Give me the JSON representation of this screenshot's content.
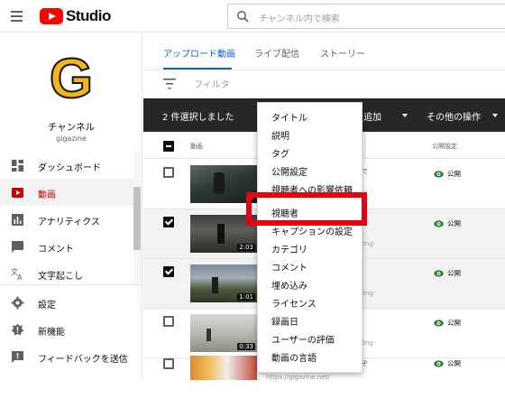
{
  "header": {
    "logo_text": "Studio",
    "search_placeholder": "チャンネル内で検索",
    "colors": {
      "brand": "#ff0000",
      "accent": "#065fd4",
      "active_nav": "#cc0000",
      "highlight": "#e60012"
    }
  },
  "sidebar": {
    "avatar_letter": "G",
    "channel_label": "チャンネル",
    "channel_handle": "gigazine",
    "items": [
      {
        "label": "ダッシュボード",
        "icon": "dashboard-icon",
        "active": false
      },
      {
        "label": "動画",
        "icon": "video-icon",
        "active": true
      },
      {
        "label": "アナリティクス",
        "icon": "analytics-icon",
        "active": false
      },
      {
        "label": "コメント",
        "icon": "comment-icon",
        "active": false
      },
      {
        "label": "文字起こし",
        "icon": "translate-icon",
        "active": false
      },
      {
        "label": "設定",
        "icon": "gear-icon",
        "active": false
      },
      {
        "label": "新機能",
        "icon": "whats-new-icon",
        "active": false
      },
      {
        "label": "フィードバックを送信",
        "icon": "feedback-icon",
        "active": false
      }
    ]
  },
  "main": {
    "tabs": [
      {
        "label": "アップロード動画",
        "active": true
      },
      {
        "label": "ライブ配信",
        "active": false
      },
      {
        "label": "ストーリー",
        "active": false
      }
    ],
    "filter_label": "フィルタ",
    "selection_bar": {
      "selected_text": "2 件選択しました",
      "add_partial": "に追加",
      "more_actions": "その他の操作"
    },
    "table": {
      "col_video": "動画",
      "col_visibility": "公開設定",
      "rows": [
        {
          "checked": false,
          "duration": "2",
          "visibility": "公開",
          "snippet": "で",
          "desc": ""
        },
        {
          "checked": true,
          "duration": "2:03",
          "visibility": "公開",
          "snippet": "",
          "desc": "ling-"
        },
        {
          "checked": true,
          "duration": "1:01",
          "visibility": "公開",
          "snippet": "",
          "desc": "ling-"
        },
        {
          "checked": false,
          "duration": "0:33",
          "visibility": "公開",
          "snippet": "",
          "desc": "ling-"
        },
        {
          "checked": false,
          "duration": "",
          "visibility": "公開",
          "snippet": "ぞ",
          "desc": "https://gigazine.net/"
        }
      ]
    }
  },
  "dropdown": {
    "items": [
      "タイトル",
      "説明",
      "タグ",
      "公開設定",
      "視聴者への影響依頼",
      "視聴者",
      "キャプションの設定",
      "カテゴリ",
      "コメント",
      "埋め込み",
      "ライセンス",
      "録画日",
      "ユーザーの評価",
      "動画の言語"
    ],
    "highlighted_item": "視聴者"
  }
}
